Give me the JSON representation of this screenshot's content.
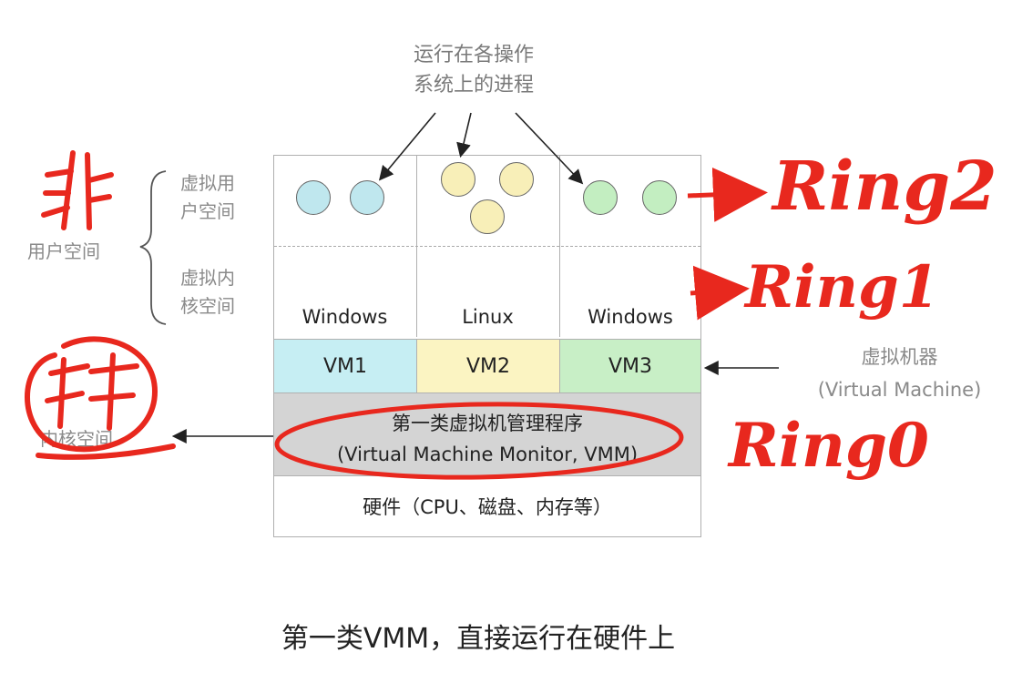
{
  "top_label": [
    "运行在各操作",
    "系统上的进程"
  ],
  "left_labels": {
    "virtual_user_space": [
      "虚拟用",
      "户空间"
    ],
    "user_space": "用户空间",
    "virtual_kernel_space": [
      "虚拟内",
      "核空间"
    ],
    "kernel_space": "内核空间"
  },
  "columns": [
    {
      "os": "Windows",
      "vm": "VM1",
      "vm_color": "#c6eef3",
      "circle_color": "#bfe7ee",
      "circles": 2
    },
    {
      "os": "Linux",
      "vm": "VM2",
      "vm_color": "#fbf4c2",
      "circle_color": "#f8efb8",
      "circles": 3
    },
    {
      "os": "Windows",
      "vm": "VM3",
      "vm_color": "#c8efc6",
      "circle_color": "#c3eec1",
      "circles": 2
    }
  ],
  "vmm": {
    "line1": "第一类虚拟机管理程序",
    "line2": "(Virtual Machine Monitor, VMM)",
    "color": "#d4d4d4"
  },
  "hardware": "硬件（CPU、磁盘、内存等）",
  "right_label": {
    "line1": "虚拟机器",
    "line2": "(Virtual Machine)"
  },
  "caption": "第一类VMM，直接运行在硬件上",
  "annotations": {
    "ring2": "Ring2",
    "ring1": "Ring1",
    "ring0": "Ring0",
    "handwritten_left_top": "非",
    "handwritten_left_bottom": "特",
    "ink_color": "#e8281e"
  }
}
